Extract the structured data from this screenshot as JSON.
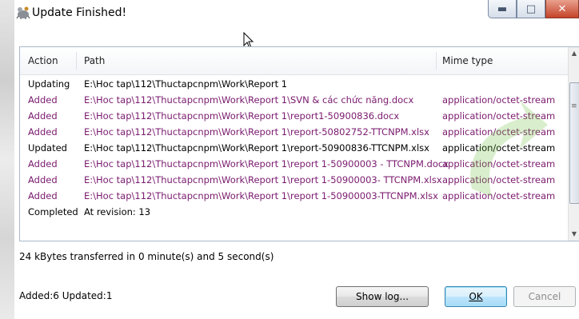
{
  "window": {
    "title": "Update Finished!",
    "icons": {
      "app": "tortoise-svn-icon",
      "minimize": "minimize-icon",
      "maximize": "maximize-icon",
      "close": "close-icon"
    }
  },
  "table": {
    "columns": {
      "action": "Action",
      "path": "Path",
      "mime": "Mime type"
    },
    "rows": [
      {
        "action": "Updating",
        "path": "E:\\Hoc tap\\112\\Thuctapcnpm\\Work\\Report 1",
        "mime": "",
        "kind": "normal"
      },
      {
        "action": "Added",
        "path": "E:\\Hoc tap\\112\\Thuctapcnpm\\Work\\Report 1\\SVN & các chức năng.docx",
        "mime": "application/octet-stream",
        "kind": "added"
      },
      {
        "action": "Added",
        "path": "E:\\Hoc tap\\112\\Thuctapcnpm\\Work\\Report 1\\report1-50900836.docx",
        "mime": "application/octet-stream",
        "kind": "added"
      },
      {
        "action": "Added",
        "path": "E:\\Hoc tap\\112\\Thuctapcnpm\\Work\\Report 1\\report-50802752-TTCNPM.xlsx",
        "mime": "application/octet-stream",
        "kind": "added"
      },
      {
        "action": "Updated",
        "path": "E:\\Hoc tap\\112\\Thuctapcnpm\\Work\\Report 1\\report-50900836-TTCNPM.xlsx",
        "mime": "application/octet-stream",
        "kind": "normal"
      },
      {
        "action": "Added",
        "path": "E:\\Hoc tap\\112\\Thuctapcnpm\\Work\\Report 1\\report 1-50900003 - TTCNPM.docx",
        "mime": "application/octet-stream",
        "kind": "added"
      },
      {
        "action": "Added",
        "path": "E:\\Hoc tap\\112\\Thuctapcnpm\\Work\\Report 1\\report 1-50900003- TTCNPM.xlsx",
        "mime": "application/octet-stream",
        "kind": "added"
      },
      {
        "action": "Added",
        "path": "E:\\Hoc tap\\112\\Thuctapcnpm\\Work\\Report 1\\report 1-50900003-TTCNPM.xlsx",
        "mime": "application/octet-stream",
        "kind": "added"
      },
      {
        "action": "Completed",
        "path": "At revision: 13",
        "mime": "",
        "kind": "normal"
      }
    ]
  },
  "status": {
    "transfer": "24 kBytes transferred in 0 minute(s) and 5 second(s)",
    "summary": "Added:6 Updated:1"
  },
  "buttons": {
    "show_log": "Show log...",
    "ok": "OK",
    "cancel": "Cancel"
  },
  "colors": {
    "added": "#7a1a6e",
    "normal": "#000000",
    "ok_border": "#3c7fb1"
  }
}
